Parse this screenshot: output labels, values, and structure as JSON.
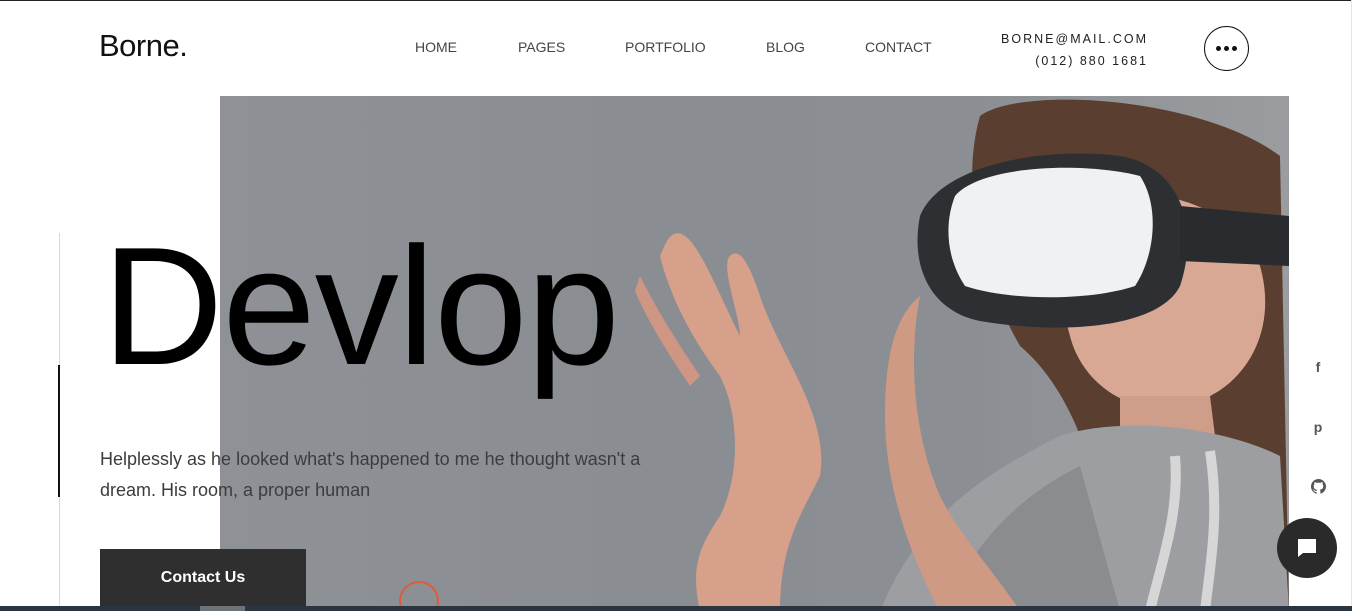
{
  "brand": {
    "logo": "Borne."
  },
  "nav": {
    "items": [
      {
        "label": "HOME"
      },
      {
        "label": "PAGES"
      },
      {
        "label": "PORTFOLIO"
      },
      {
        "label": "BLOG"
      },
      {
        "label": "CONTACT"
      }
    ]
  },
  "contact": {
    "email": "BORNE@MAIL.COM",
    "phone": "(012) 880 1681"
  },
  "hero": {
    "headline": "Devlop",
    "description": "Helplessly as he looked what's happened to me he thought wasn't a dream. His room, a proper human",
    "cta_label": "Contact Us"
  },
  "social": {
    "facebook_glyph": "f",
    "pinterest_glyph": "p"
  },
  "icons": {
    "menu": "more-dots-icon",
    "chat": "chat-bubble-icon",
    "github": "github-icon"
  },
  "colors": {
    "accent": "#e05a3c",
    "dark": "#2f2f2f"
  }
}
